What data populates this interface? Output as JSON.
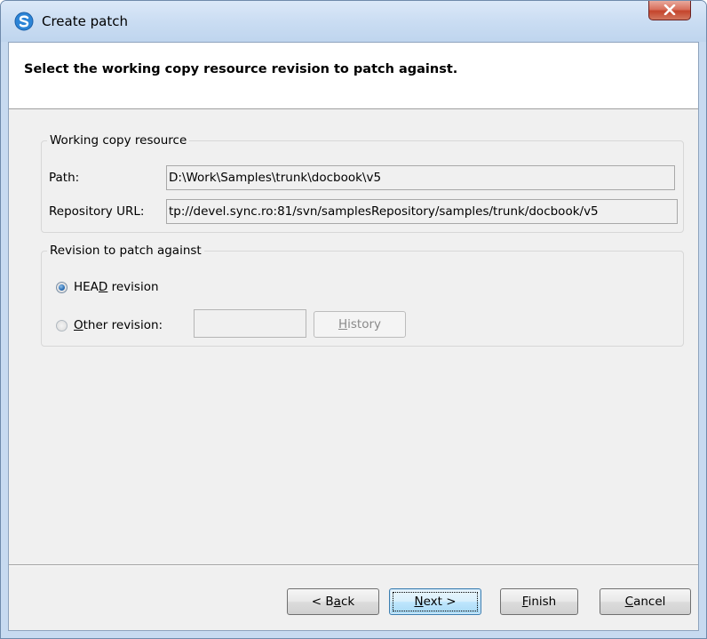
{
  "window": {
    "title": "Create patch",
    "icon": "svn-logo-icon",
    "close_icon": "close-icon"
  },
  "banner": {
    "text": "Select the working copy resource revision to patch against."
  },
  "working_copy": {
    "legend": "Working copy resource",
    "path_label": "Path:",
    "path_value": "D:\\Work\\Samples\\trunk\\docbook\\v5",
    "url_label": "Repository URL:",
    "url_value": "tp://devel.sync.ro:81/svn/samplesRepository/samples/trunk/docbook/v5"
  },
  "revision": {
    "legend": "Revision to patch against",
    "head": {
      "pre": "HEA",
      "mnemonic": "D",
      "post": " revision",
      "checked": true
    },
    "other": {
      "pre": "",
      "mnemonic": "O",
      "post": "ther revision:",
      "checked": false,
      "value": ""
    },
    "history": {
      "pre": "",
      "mnemonic": "H",
      "post": "istory"
    }
  },
  "buttons": {
    "back": {
      "pre": "< B",
      "mnemonic": "a",
      "post": "ck"
    },
    "next": {
      "pre": "",
      "mnemonic": "N",
      "post": "ext >"
    },
    "finish": {
      "pre": "",
      "mnemonic": "F",
      "post": "inish"
    },
    "cancel": {
      "pre": "",
      "mnemonic": "C",
      "post": "ancel"
    }
  },
  "colors": {
    "title_bar": "#c9dcf2",
    "close_button": "#c4452c",
    "dialog_bg": "#f0f0f0",
    "default_button": "#bee6fd"
  }
}
